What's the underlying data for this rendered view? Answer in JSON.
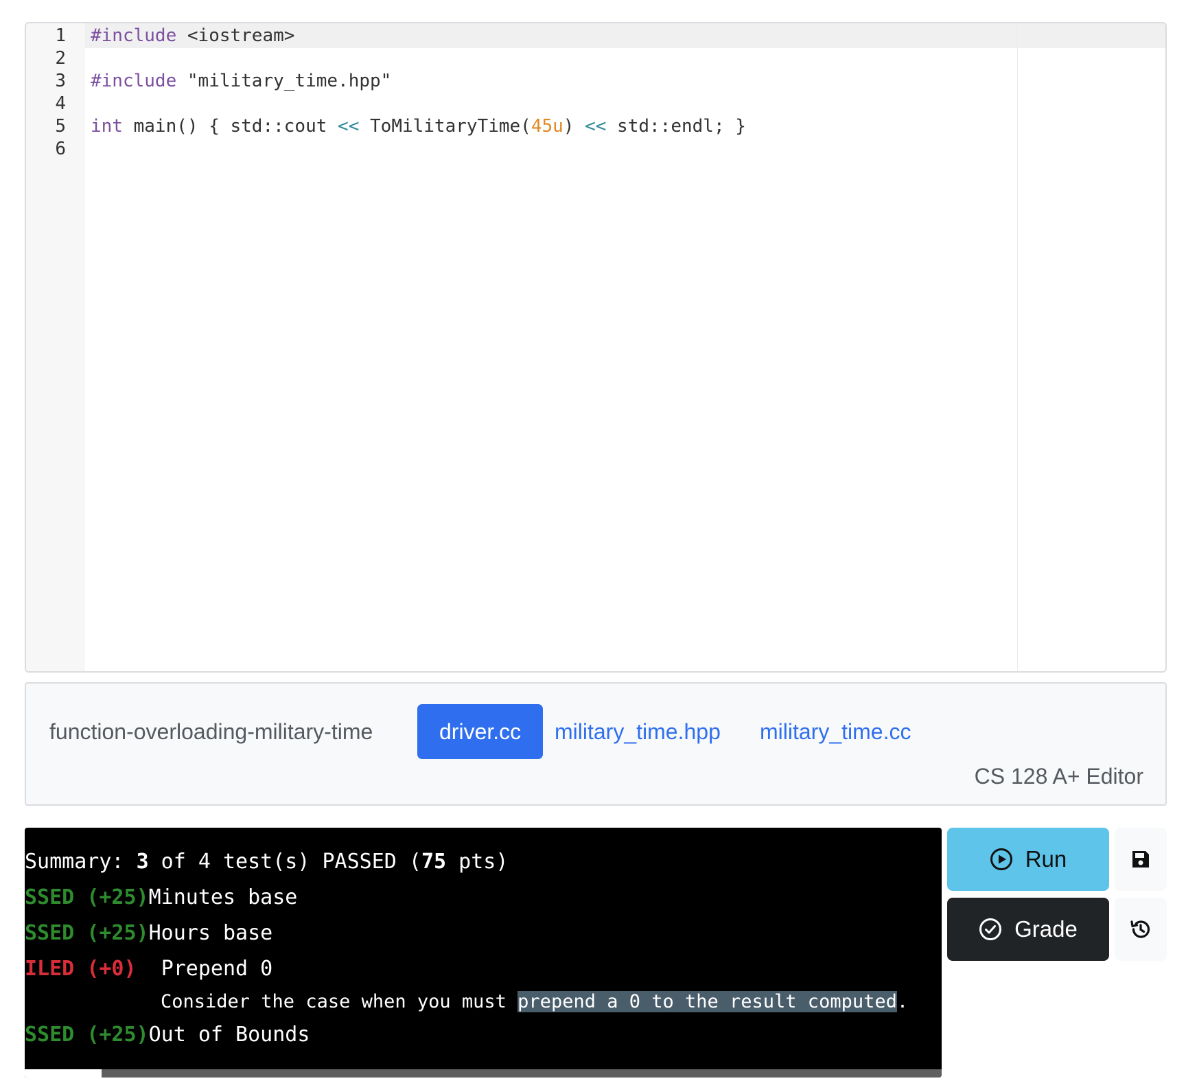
{
  "editor": {
    "line_numbers": [
      "1",
      "2",
      "3",
      "4",
      "5",
      "6"
    ],
    "lines": [
      {
        "segments": [
          {
            "t": "#include",
            "c": "kw"
          },
          {
            "t": " <iostream>",
            "c": ""
          }
        ]
      },
      {
        "segments": []
      },
      {
        "segments": [
          {
            "t": "#include",
            "c": "kw"
          },
          {
            "t": " \"military_time.hpp\"",
            "c": ""
          }
        ]
      },
      {
        "segments": []
      },
      {
        "segments": [
          {
            "t": "int",
            "c": "kw"
          },
          {
            "t": " main() { std::cout ",
            "c": ""
          },
          {
            "t": "<<",
            "c": "op"
          },
          {
            "t": " ToMilitaryTime(",
            "c": ""
          },
          {
            "t": "45u",
            "c": "num"
          },
          {
            "t": ") ",
            "c": ""
          },
          {
            "t": "<<",
            "c": "op"
          },
          {
            "t": " std::endl; }",
            "c": ""
          }
        ]
      },
      {
        "segments": []
      }
    ]
  },
  "filebar": {
    "project_name": "function-overloading-military-time",
    "tabs": [
      {
        "label": "driver.cc",
        "active": true
      },
      {
        "label": "military_time.hpp",
        "active": false
      },
      {
        "label": "military_time.cc",
        "active": false
      }
    ],
    "editor_label": "CS 128 A+ Editor"
  },
  "terminal": {
    "summary": {
      "prefix": "Summary: ",
      "passed": "3",
      "middle": " of 4 test(s) PASSED (",
      "points": "75",
      "suffix": " pts)"
    },
    "results": [
      {
        "status": "SSED",
        "points": "(+25)",
        "name": "Minutes base",
        "kind": "pass"
      },
      {
        "status": "SSED",
        "points": "(+25)",
        "name": "Hours base",
        "kind": "pass"
      },
      {
        "status": "ILED",
        "points": "(+0)",
        "name": "Prepend 0",
        "kind": "fail",
        "hint_before": "Consider the case when you must ",
        "hint_highlight": "prepend a 0 to the result computed",
        "hint_after": "."
      },
      {
        "status": "SSED",
        "points": "(+25)",
        "name": "Out of Bounds",
        "kind": "pass"
      }
    ]
  },
  "actions": {
    "run_label": "Run",
    "grade_label": "Grade",
    "save_icon": "save-icon",
    "history_icon": "history-icon",
    "run_color": "#5ec4ea",
    "grade_color": "#202427"
  }
}
